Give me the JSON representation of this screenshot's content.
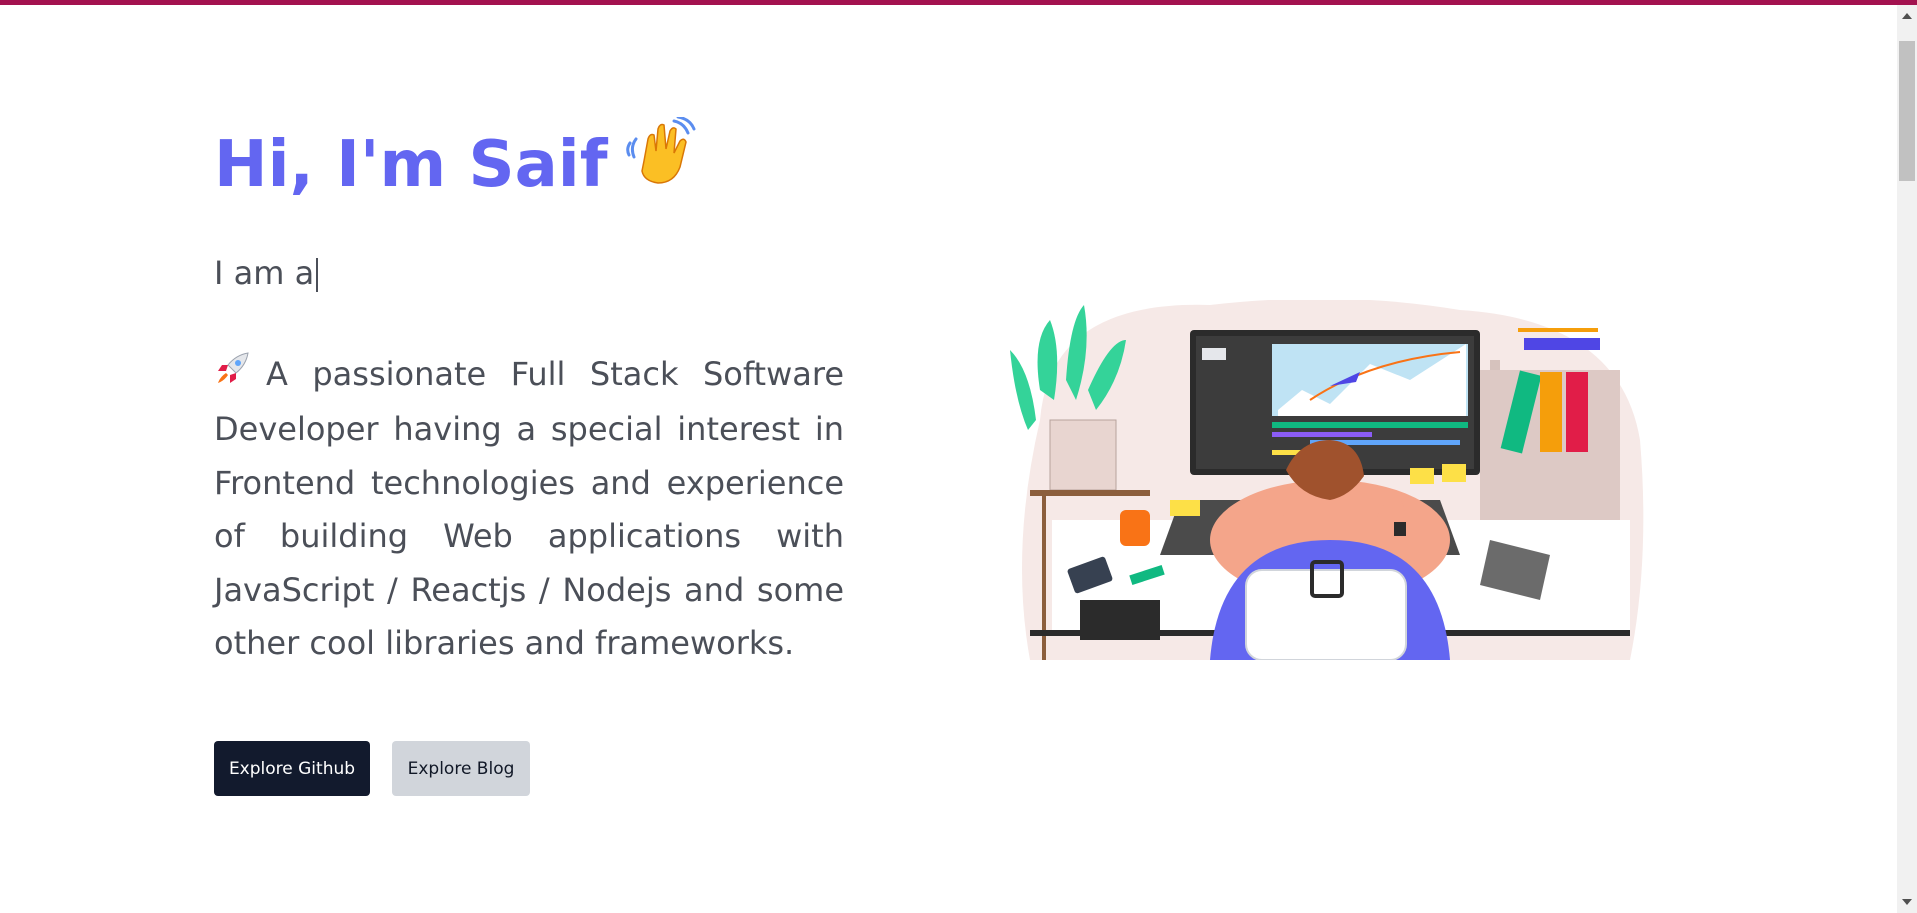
{
  "hero": {
    "greeting": "Hi, I'm Saif",
    "typing_text": "I am a",
    "intro_text": "A passionate Full Stack Software Developer having a special interest in Frontend technologies and experience of building Web applications with JavaScript / Reactjs / Nodejs and some other cool libraries and frameworks."
  },
  "buttons": {
    "github_label": "Explore Github",
    "blog_label": "Explore Blog"
  },
  "icons": {
    "wave": "waving-hand-icon",
    "rocket": "rocket-icon"
  },
  "colors": {
    "accent": "#6366f1",
    "top_bar": "#a3124f",
    "dark_button": "#121a2d",
    "light_button": "#d1d5db",
    "body_text": "#4b4f58"
  }
}
